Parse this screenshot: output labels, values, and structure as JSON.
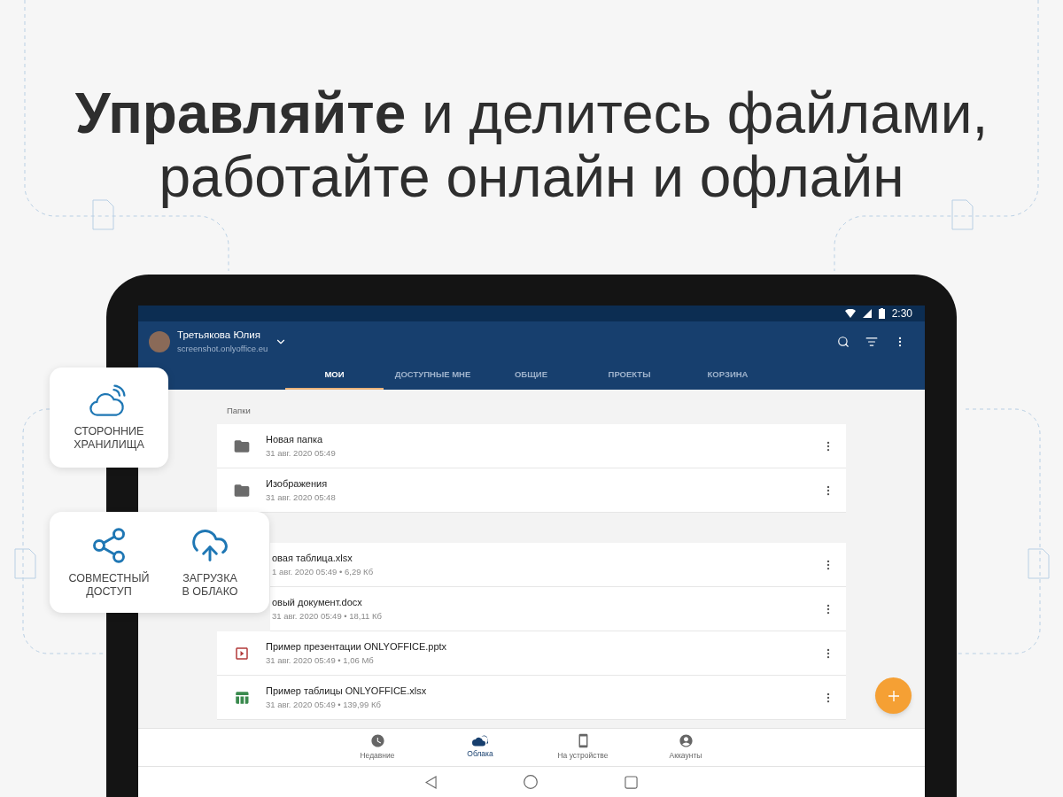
{
  "headline": [
    "**Управляйте** и делитесь файлами,",
    "работайте онлайн и офлайн"
  ],
  "status_bar": {
    "time": "2:30"
  },
  "account": {
    "name": "Третьякова Юлия",
    "host": "screenshot.onlyoffice.eu"
  },
  "tabs": [
    {
      "label": "МОИ",
      "selected": true
    },
    {
      "label": "ДОСТУПНЫЕ МНЕ",
      "selected": false
    },
    {
      "label": "ОБЩИЕ",
      "selected": false
    },
    {
      "label": "ПРОЕКТЫ",
      "selected": false
    },
    {
      "label": "КОРЗИНА",
      "selected": false
    }
  ],
  "folders_header": "Папки",
  "folders": [
    {
      "name": "Новая папка",
      "meta": "31 авг. 2020 05:49",
      "kind": "folder"
    },
    {
      "name": "Изображения",
      "meta": "31 авг. 2020 05:48",
      "kind": "folder"
    }
  ],
  "files": [
    {
      "name": "овая таблица.xlsx",
      "meta": "1 авг. 2020 05:49 • 6,29 Кб",
      "kind": "covered"
    },
    {
      "name": "овый документ.docx",
      "meta": "31 авг. 2020 05:49 • 18,11 Кб",
      "kind": "covered"
    },
    {
      "name": "Пример презентации ONLYOFFICE.pptx",
      "meta": "31 авг. 2020 05:49 • 1,06 Мб",
      "kind": "presentation"
    },
    {
      "name": "Пример таблицы ONLYOFFICE.xlsx",
      "meta": "31 авг. 2020 05:49 • 139,99 Кб",
      "kind": "spreadsheet"
    }
  ],
  "bottom_nav": [
    {
      "label": "Недавние",
      "kind": "clock",
      "selected": false
    },
    {
      "label": "Облака",
      "kind": "clouds",
      "selected": true
    },
    {
      "label": "На устройстве",
      "kind": "phone",
      "selected": false
    },
    {
      "label": "Аккаунты",
      "kind": "account",
      "selected": false
    }
  ],
  "feature_cards": [
    {
      "items": [
        {
          "kind": "cloud-signal",
          "label": "СТОРОННИЕ\nХРАНИЛИЩА"
        }
      ]
    },
    {
      "items": [
        {
          "kind": "share",
          "label": "СОВМЕСТНЫЙ\nДОСТУП"
        },
        {
          "kind": "upload",
          "label": "ЗАГРУЗКА\nВ ОБЛАКО"
        }
      ]
    }
  ]
}
